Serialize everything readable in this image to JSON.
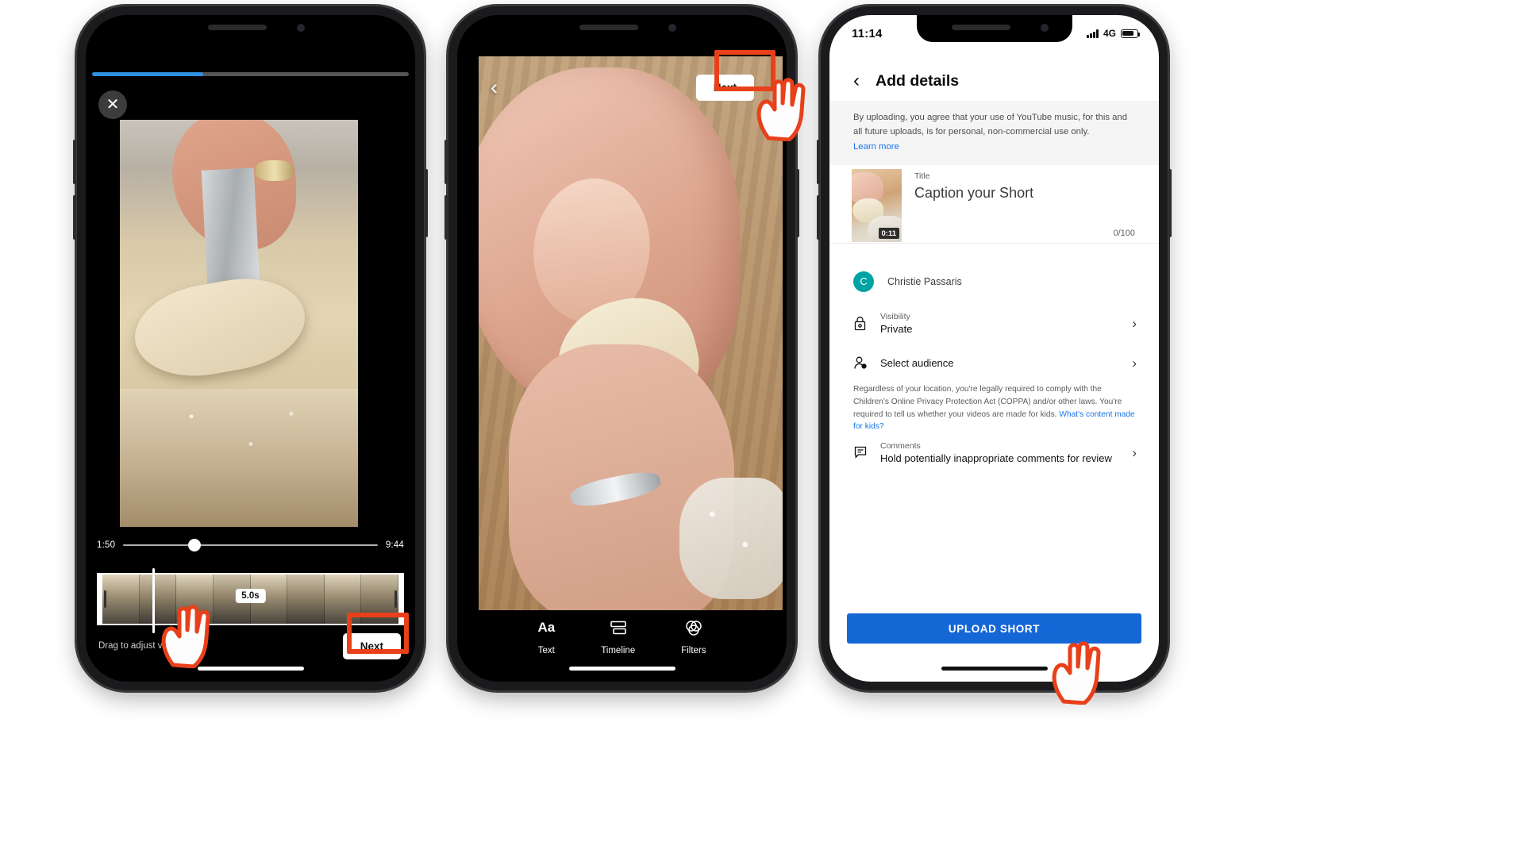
{
  "phone1": {
    "name": "video-trim-editor",
    "close_icon_label": "✕",
    "progress_percent": 35,
    "scrubber": {
      "start_time": "1:50",
      "end_time": "9:44"
    },
    "clip_duration": "5.0s",
    "hint_text": "Drag to adjust video",
    "next_label": "Next"
  },
  "phone2": {
    "name": "shorts-preview-editor",
    "back_icon_label": "‹",
    "next_label": "Next",
    "tools": [
      {
        "icon": "text-icon",
        "glyph": "Aa",
        "label": "Text"
      },
      {
        "icon": "timeline-icon",
        "glyph": "",
        "label": "Timeline"
      },
      {
        "icon": "filters-icon",
        "glyph": "",
        "label": "Filters"
      }
    ]
  },
  "phone3": {
    "name": "add-details-screen",
    "status_bar": {
      "time": "11:14",
      "network": "4G",
      "battery_level": 68
    },
    "header": {
      "back_icon_label": "‹",
      "title": "Add details"
    },
    "banner": {
      "text": "By uploading, you agree that your use of YouTube music, for this and all future uploads, is for personal, non-commercial use only.",
      "link": "Learn more"
    },
    "title_section": {
      "label": "Title",
      "placeholder": "Caption your Short",
      "char_count": "0/100",
      "thumbnail_duration": "0:11"
    },
    "account": {
      "initial": "C",
      "name": "Christie Passaris",
      "avatar_color": "#00a3a3"
    },
    "visibility": {
      "label": "Visibility",
      "value": "Private",
      "icon": "lock-icon"
    },
    "audience": {
      "label": "Select audience",
      "icon": "person-add-icon"
    },
    "coppa": {
      "text": "Regardless of your location, you're legally required to comply with the Children's Online Privacy Protection Act (COPPA) and/or other laws. You're required to tell us whether your videos are made for kids. ",
      "link": "What's content made for kids?"
    },
    "comments": {
      "label": "Comments",
      "value": "Hold potentially inappropriate comments for review",
      "icon": "comment-icon"
    },
    "upload_button": "UPLOAD SHORT",
    "accent_color": "#1667d6"
  },
  "annotations": {
    "highlight_color": "#e8401a",
    "cursor_count": 3
  }
}
